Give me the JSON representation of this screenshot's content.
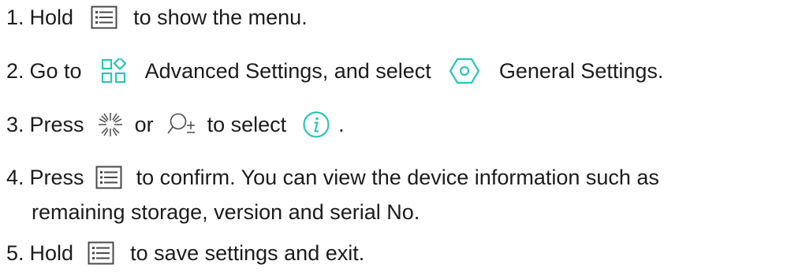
{
  "steps": [
    {
      "num": "1.",
      "parts": {
        "a": "Hold",
        "b": "to show the menu."
      },
      "icons": [
        "menu-icon"
      ]
    },
    {
      "num": "2.",
      "parts": {
        "a": "Go to",
        "b": "Advanced Settings, and select",
        "c": "General Settings."
      },
      "icons": [
        "advanced-settings-icon",
        "general-settings-icon"
      ]
    },
    {
      "num": "3.",
      "parts": {
        "a": "Press",
        "b": "or",
        "c": "to select",
        "d": "."
      },
      "icons": [
        "brightness-icon",
        "zoom-icon",
        "info-icon"
      ]
    },
    {
      "num": "4.",
      "parts": {
        "a": "Press",
        "b": "to confirm. You can view the device information such as",
        "c": "remaining storage, version and serial No."
      },
      "icons": [
        "menu-icon"
      ]
    },
    {
      "num": "5.",
      "parts": {
        "a": "Hold",
        "b": "to save settings and exit."
      },
      "icons": [
        "menu-icon"
      ]
    }
  ],
  "colors": {
    "text": "#1c1c1c",
    "accent": "#2ec4b6",
    "menu_icon": "#4a4a4a"
  }
}
